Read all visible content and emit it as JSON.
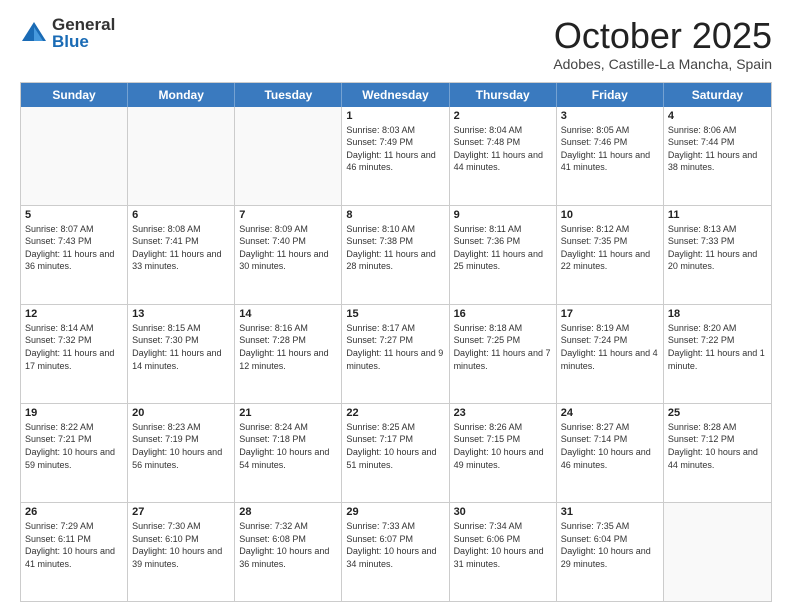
{
  "logo": {
    "general": "General",
    "blue": "Blue"
  },
  "header": {
    "month": "October 2025",
    "location": "Adobes, Castille-La Mancha, Spain"
  },
  "weekdays": [
    "Sunday",
    "Monday",
    "Tuesday",
    "Wednesday",
    "Thursday",
    "Friday",
    "Saturday"
  ],
  "weeks": [
    [
      {
        "day": "",
        "sunrise": "",
        "sunset": "",
        "daylight": ""
      },
      {
        "day": "",
        "sunrise": "",
        "sunset": "",
        "daylight": ""
      },
      {
        "day": "",
        "sunrise": "",
        "sunset": "",
        "daylight": ""
      },
      {
        "day": "1",
        "sunrise": "Sunrise: 8:03 AM",
        "sunset": "Sunset: 7:49 PM",
        "daylight": "Daylight: 11 hours and 46 minutes."
      },
      {
        "day": "2",
        "sunrise": "Sunrise: 8:04 AM",
        "sunset": "Sunset: 7:48 PM",
        "daylight": "Daylight: 11 hours and 44 minutes."
      },
      {
        "day": "3",
        "sunrise": "Sunrise: 8:05 AM",
        "sunset": "Sunset: 7:46 PM",
        "daylight": "Daylight: 11 hours and 41 minutes."
      },
      {
        "day": "4",
        "sunrise": "Sunrise: 8:06 AM",
        "sunset": "Sunset: 7:44 PM",
        "daylight": "Daylight: 11 hours and 38 minutes."
      }
    ],
    [
      {
        "day": "5",
        "sunrise": "Sunrise: 8:07 AM",
        "sunset": "Sunset: 7:43 PM",
        "daylight": "Daylight: 11 hours and 36 minutes."
      },
      {
        "day": "6",
        "sunrise": "Sunrise: 8:08 AM",
        "sunset": "Sunset: 7:41 PM",
        "daylight": "Daylight: 11 hours and 33 minutes."
      },
      {
        "day": "7",
        "sunrise": "Sunrise: 8:09 AM",
        "sunset": "Sunset: 7:40 PM",
        "daylight": "Daylight: 11 hours and 30 minutes."
      },
      {
        "day": "8",
        "sunrise": "Sunrise: 8:10 AM",
        "sunset": "Sunset: 7:38 PM",
        "daylight": "Daylight: 11 hours and 28 minutes."
      },
      {
        "day": "9",
        "sunrise": "Sunrise: 8:11 AM",
        "sunset": "Sunset: 7:36 PM",
        "daylight": "Daylight: 11 hours and 25 minutes."
      },
      {
        "day": "10",
        "sunrise": "Sunrise: 8:12 AM",
        "sunset": "Sunset: 7:35 PM",
        "daylight": "Daylight: 11 hours and 22 minutes."
      },
      {
        "day": "11",
        "sunrise": "Sunrise: 8:13 AM",
        "sunset": "Sunset: 7:33 PM",
        "daylight": "Daylight: 11 hours and 20 minutes."
      }
    ],
    [
      {
        "day": "12",
        "sunrise": "Sunrise: 8:14 AM",
        "sunset": "Sunset: 7:32 PM",
        "daylight": "Daylight: 11 hours and 17 minutes."
      },
      {
        "day": "13",
        "sunrise": "Sunrise: 8:15 AM",
        "sunset": "Sunset: 7:30 PM",
        "daylight": "Daylight: 11 hours and 14 minutes."
      },
      {
        "day": "14",
        "sunrise": "Sunrise: 8:16 AM",
        "sunset": "Sunset: 7:28 PM",
        "daylight": "Daylight: 11 hours and 12 minutes."
      },
      {
        "day": "15",
        "sunrise": "Sunrise: 8:17 AM",
        "sunset": "Sunset: 7:27 PM",
        "daylight": "Daylight: 11 hours and 9 minutes."
      },
      {
        "day": "16",
        "sunrise": "Sunrise: 8:18 AM",
        "sunset": "Sunset: 7:25 PM",
        "daylight": "Daylight: 11 hours and 7 minutes."
      },
      {
        "day": "17",
        "sunrise": "Sunrise: 8:19 AM",
        "sunset": "Sunset: 7:24 PM",
        "daylight": "Daylight: 11 hours and 4 minutes."
      },
      {
        "day": "18",
        "sunrise": "Sunrise: 8:20 AM",
        "sunset": "Sunset: 7:22 PM",
        "daylight": "Daylight: 11 hours and 1 minute."
      }
    ],
    [
      {
        "day": "19",
        "sunrise": "Sunrise: 8:22 AM",
        "sunset": "Sunset: 7:21 PM",
        "daylight": "Daylight: 10 hours and 59 minutes."
      },
      {
        "day": "20",
        "sunrise": "Sunrise: 8:23 AM",
        "sunset": "Sunset: 7:19 PM",
        "daylight": "Daylight: 10 hours and 56 minutes."
      },
      {
        "day": "21",
        "sunrise": "Sunrise: 8:24 AM",
        "sunset": "Sunset: 7:18 PM",
        "daylight": "Daylight: 10 hours and 54 minutes."
      },
      {
        "day": "22",
        "sunrise": "Sunrise: 8:25 AM",
        "sunset": "Sunset: 7:17 PM",
        "daylight": "Daylight: 10 hours and 51 minutes."
      },
      {
        "day": "23",
        "sunrise": "Sunrise: 8:26 AM",
        "sunset": "Sunset: 7:15 PM",
        "daylight": "Daylight: 10 hours and 49 minutes."
      },
      {
        "day": "24",
        "sunrise": "Sunrise: 8:27 AM",
        "sunset": "Sunset: 7:14 PM",
        "daylight": "Daylight: 10 hours and 46 minutes."
      },
      {
        "day": "25",
        "sunrise": "Sunrise: 8:28 AM",
        "sunset": "Sunset: 7:12 PM",
        "daylight": "Daylight: 10 hours and 44 minutes."
      }
    ],
    [
      {
        "day": "26",
        "sunrise": "Sunrise: 7:29 AM",
        "sunset": "Sunset: 6:11 PM",
        "daylight": "Daylight: 10 hours and 41 minutes."
      },
      {
        "day": "27",
        "sunrise": "Sunrise: 7:30 AM",
        "sunset": "Sunset: 6:10 PM",
        "daylight": "Daylight: 10 hours and 39 minutes."
      },
      {
        "day": "28",
        "sunrise": "Sunrise: 7:32 AM",
        "sunset": "Sunset: 6:08 PM",
        "daylight": "Daylight: 10 hours and 36 minutes."
      },
      {
        "day": "29",
        "sunrise": "Sunrise: 7:33 AM",
        "sunset": "Sunset: 6:07 PM",
        "daylight": "Daylight: 10 hours and 34 minutes."
      },
      {
        "day": "30",
        "sunrise": "Sunrise: 7:34 AM",
        "sunset": "Sunset: 6:06 PM",
        "daylight": "Daylight: 10 hours and 31 minutes."
      },
      {
        "day": "31",
        "sunrise": "Sunrise: 7:35 AM",
        "sunset": "Sunset: 6:04 PM",
        "daylight": "Daylight: 10 hours and 29 minutes."
      },
      {
        "day": "",
        "sunrise": "",
        "sunset": "",
        "daylight": ""
      }
    ]
  ]
}
